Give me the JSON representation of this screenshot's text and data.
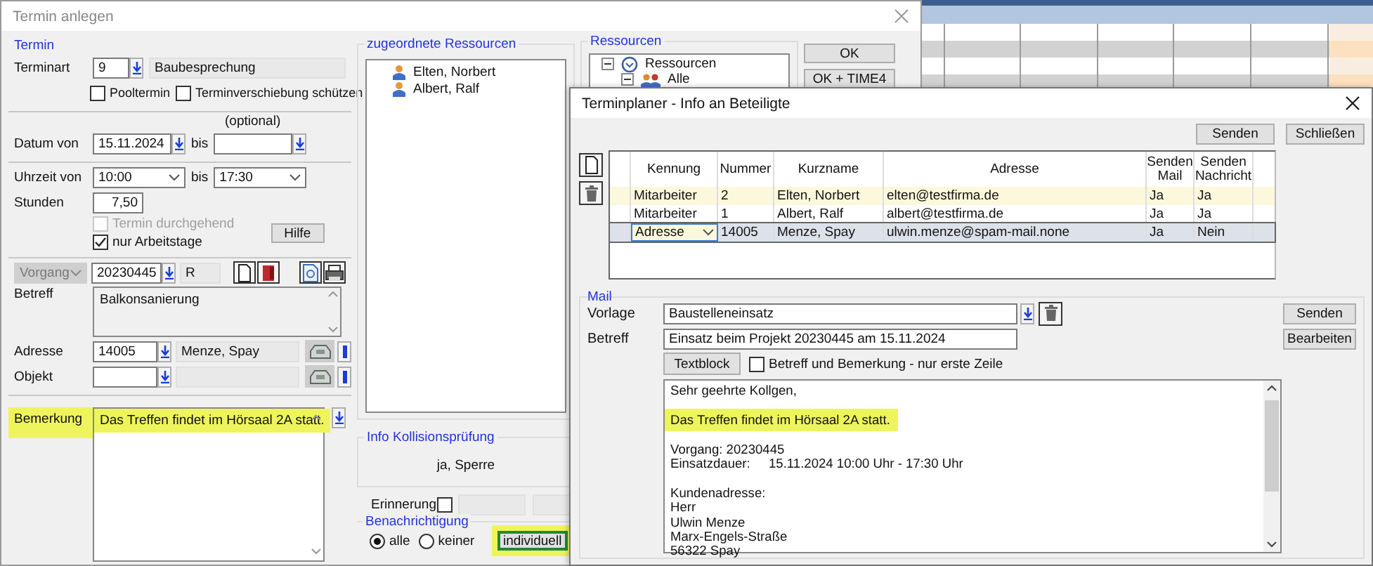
{
  "main_window": {
    "title": "Termin anlegen",
    "termin": {
      "legend": "Termin",
      "terminart_label": "Terminart",
      "terminart_value": "9",
      "terminart_name": "Baubesprechung",
      "checkboxes": [
        {
          "label": "Pooltermin",
          "checked": false
        },
        {
          "label": "Terminverschiebung schützen",
          "checked": false
        }
      ]
    },
    "datum": {
      "label": "Datum von",
      "from": "15.11.2024",
      "bis": "bis",
      "optional": "(optional)"
    },
    "uhrzeit": {
      "label": "Uhrzeit von",
      "from": "10:00",
      "bis": "bis",
      "to": "17:30",
      "stunden_label": "Stunden",
      "stunden": "7,50",
      "help_button": "Hilfe",
      "checkboxes": [
        {
          "label": "Termin durchgehend",
          "checked": false,
          "disabled": true
        },
        {
          "label": "nur Arbeitstage",
          "checked": true,
          "disabled": false
        }
      ]
    },
    "vorgang": {
      "type_select": "Vorgang",
      "type_disabled": true,
      "number": "20230445",
      "code": "R",
      "betreff_label": "Betreff",
      "betreff": "Balkonsanierung",
      "adresse_label": "Adresse",
      "adresse_number": "14005",
      "adresse_name": "Menze, Spay",
      "objekt_label": "Objekt"
    },
    "bemerkung": {
      "label": "Bemerkung",
      "text": "Das Treffen findet im Hörsaal 2A statt.",
      "highlighted": true
    },
    "resources_assigned": {
      "legend": "zugeordnete Ressourcen",
      "items": [
        {
          "name": "Elten, Norbert"
        },
        {
          "name": "Albert, Ralf"
        }
      ]
    },
    "collision": {
      "legend": "Info Kollisionsprüfung",
      "text": "ja, Sperre"
    },
    "reminder": {
      "label": "Erinnerung",
      "checked": false
    },
    "notification": {
      "legend": "Benachrichtigung",
      "options": [
        {
          "label": "alle",
          "selected": true
        },
        {
          "label": "keiner",
          "selected": false
        }
      ],
      "button": "individuell",
      "highlighted": true
    },
    "resource_tree": {
      "legend": "Ressourcen",
      "items": [
        {
          "label": "Ressourcen",
          "kind": "clock",
          "expanded": true,
          "children": [
            {
              "label": "Alle",
              "kind": "group",
              "expanded": true
            }
          ]
        }
      ]
    },
    "buttons": [
      "OK",
      "OK + TIME4"
    ]
  },
  "info_window": {
    "title": "Terminplaner - Info an Beteiligte",
    "top_buttons": [
      "Senden",
      "Schließen"
    ],
    "table": {
      "columns": [
        "Kennung",
        "Nummer",
        "Kurzname",
        "Adresse",
        "Senden Mail",
        "Senden Nachricht"
      ],
      "rows": [
        {
          "highlighted": true,
          "selected": false,
          "cells": [
            "Mitarbeiter",
            "2",
            "Elten, Norbert",
            "elten@testfirma.de",
            "Ja",
            "Ja"
          ]
        },
        {
          "highlighted": false,
          "selected": false,
          "cells": [
            "Mitarbeiter",
            "1",
            "Albert, Ralf",
            "albert@testfirma.de",
            "Ja",
            "Ja"
          ]
        },
        {
          "highlighted": false,
          "selected": true,
          "cells": [
            "Adresse",
            "14005",
            "Menze, Spay",
            "ulwin.menze@spam-mail.none",
            "Ja",
            "Nein"
          ]
        }
      ]
    },
    "mail": {
      "legend": "Mail",
      "vorlage_label": "Vorlage",
      "vorlage": "Baustelleneinsatz",
      "betreff_label": "Betreff",
      "betreff": "Einsatz beim Projekt 20230445 am 15.11.2024",
      "textblock_button": "Textblock",
      "first_line_only": {
        "label": "Betreff und Bemerkung - nur erste Zeile",
        "checked": false
      },
      "body": [
        {
          "kind": "text",
          "text": "Sehr geehrte Kollgen,"
        },
        {
          "kind": "blank"
        },
        {
          "kind": "text",
          "text": "Das Treffen findet im Hörsaal 2A statt.",
          "highlighted": true
        },
        {
          "kind": "blank"
        },
        {
          "kind": "text",
          "text": "Vorgang: 20230445"
        },
        {
          "kind": "pair",
          "label": "Einsatzdauer:",
          "value": "15.11.2024 10:00 Uhr - 17:30 Uhr"
        },
        {
          "kind": "blank"
        },
        {
          "kind": "text",
          "text": "Kundenadresse:"
        },
        {
          "kind": "text",
          "text": "Herr"
        },
        {
          "kind": "text",
          "text": "Ulwin Menze"
        },
        {
          "kind": "text",
          "text": "Marx-Engels-Straße"
        },
        {
          "kind": "text",
          "text": "56322 Spay"
        }
      ],
      "buttons": [
        "Senden",
        "Bearbeiten"
      ]
    }
  }
}
